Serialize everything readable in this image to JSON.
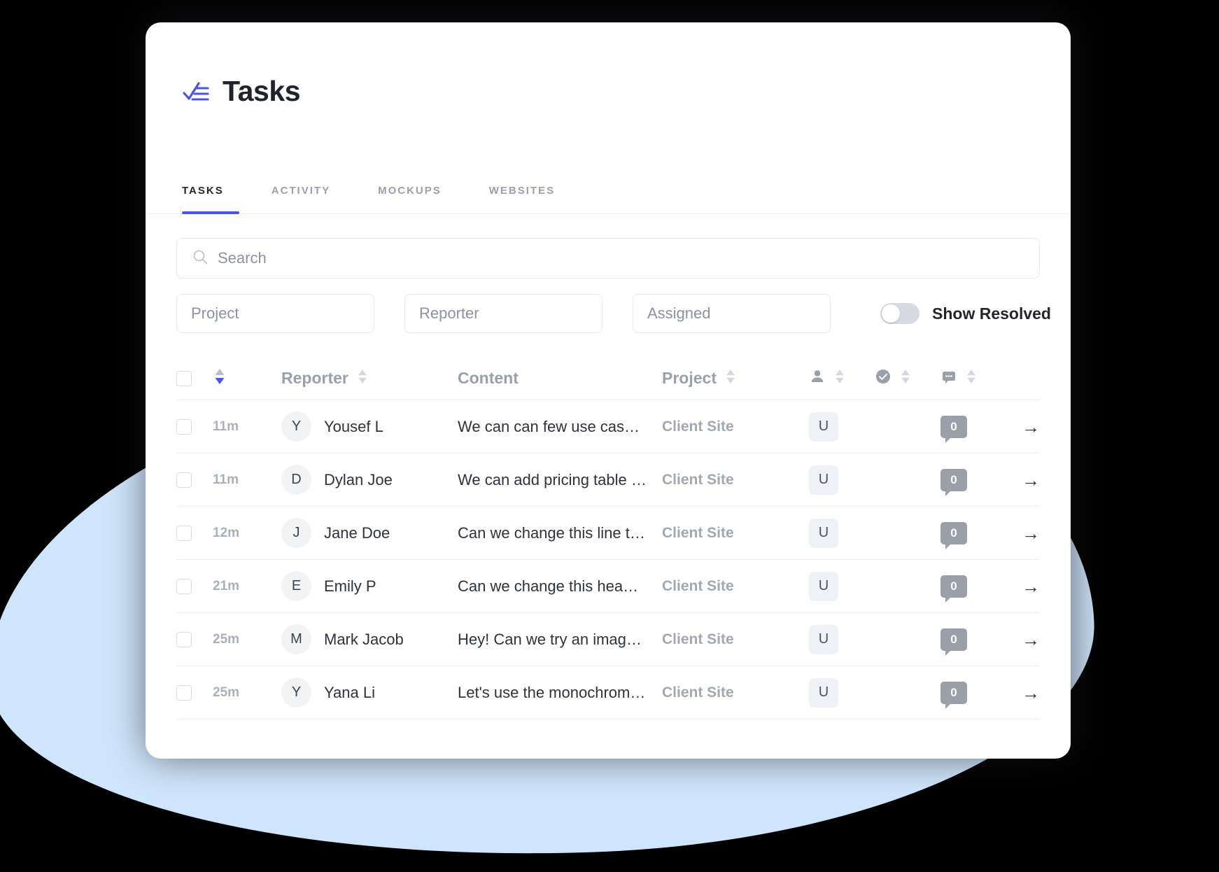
{
  "app": {
    "title": "Tasks",
    "logo_icon": "check-list-icon",
    "accent_color": "#4a55e8",
    "blob_color": "#cfe5fb"
  },
  "tabs": [
    {
      "label": "TASKS",
      "active": true
    },
    {
      "label": "ACTIVITY",
      "active": false
    },
    {
      "label": "MOCKUPS",
      "active": false
    },
    {
      "label": "WEBSITES",
      "active": false
    }
  ],
  "search": {
    "placeholder": "Search",
    "value": "",
    "icon": "search-icon"
  },
  "filters": {
    "project": {
      "placeholder": "Project",
      "value": ""
    },
    "reporter": {
      "placeholder": "Reporter",
      "value": ""
    },
    "assigned": {
      "placeholder": "Assigned",
      "value": ""
    },
    "show_resolved": {
      "label": "Show Resolved",
      "checked": false
    }
  },
  "table": {
    "headers": {
      "select_all": "",
      "time": "",
      "reporter": "Reporter",
      "content": "Content",
      "project": "Project",
      "assignee_icon": "person-icon",
      "resolved_icon": "check-circle-icon",
      "comments_icon": "comment-icon"
    },
    "sort": {
      "time_active_direction": "desc",
      "active_color": "#4a55e8",
      "inactive_color": "#d5d9df"
    },
    "rows": [
      {
        "time": "11m",
        "avatar_initial": "Y",
        "reporter": "Yousef L",
        "content": "We can can few use cases here f...",
        "project": "Client Site",
        "assignee": "U",
        "comments": "0",
        "go": "→"
      },
      {
        "time": "11m",
        "avatar_initial": "D",
        "reporter": "Dylan Joe",
        "content": "We can add pricing table here",
        "project": "Client Site",
        "assignee": "U",
        "comments": "0",
        "go": "→"
      },
      {
        "time": "12m",
        "avatar_initial": "J",
        "reporter": "Jane Doe",
        "content": "Can we change this line to: He es...",
        "project": "Client Site",
        "assignee": "U",
        "comments": "0",
        "go": "→"
      },
      {
        "time": "21m",
        "avatar_initial": "E",
        "reporter": "Emily P",
        "content": "Can we change this heading to so...",
        "project": "Client Site",
        "assignee": "U",
        "comments": "0",
        "go": "→"
      },
      {
        "time": "25m",
        "avatar_initial": "M",
        "reporter": "Mark Jacob",
        "content": "Hey! Can we try an image with be...",
        "project": "Client Site",
        "assignee": "U",
        "comments": "0",
        "go": "→"
      },
      {
        "time": "25m",
        "avatar_initial": "Y",
        "reporter": "Yana Li",
        "content": "Let's use the monochrome logo o...",
        "project": "Client Site",
        "assignee": "U",
        "comments": "0",
        "go": "→"
      }
    ]
  }
}
